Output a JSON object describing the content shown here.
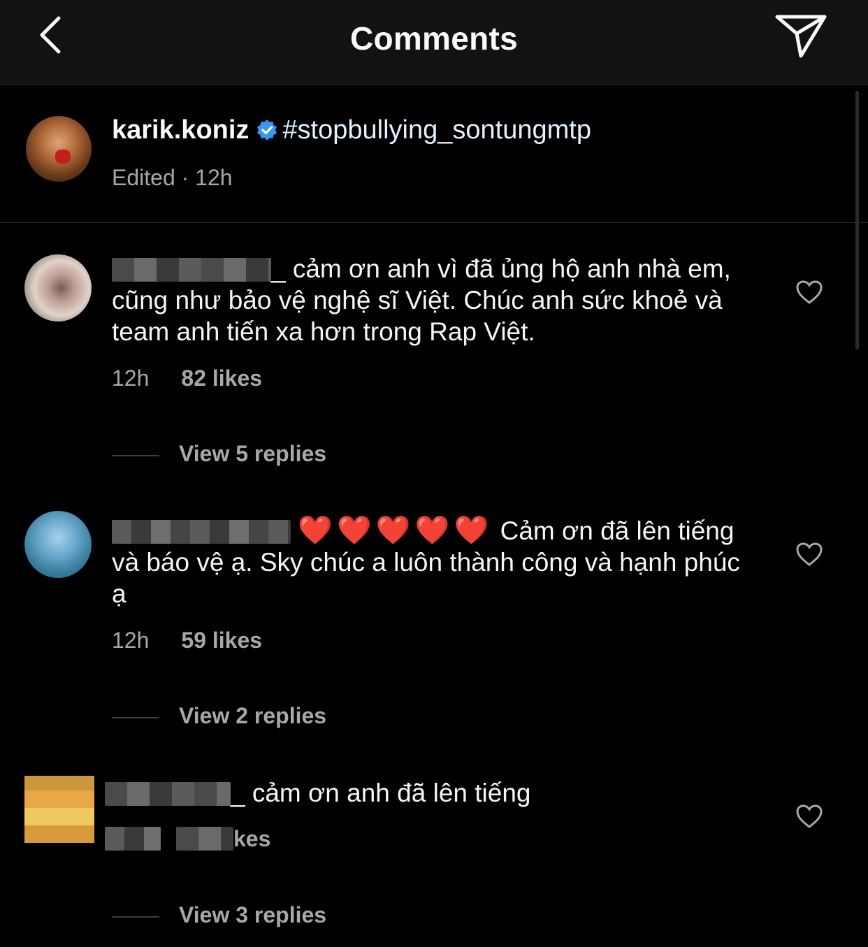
{
  "header": {
    "title": "Comments"
  },
  "caption": {
    "username": "karik.koniz",
    "text": "#stopbullying_sontungmtp",
    "meta": "Edited · 12h"
  },
  "comments": [
    {
      "text": "_ cảm ơn anh vì đã ủng hộ anh nhà em, cũng như bảo vệ nghệ sĩ Việt. Chúc anh sức khoẻ và team anh tiến xa hơn trong Rap Việt.",
      "time": "12h",
      "likes": "82 likes",
      "replies": "View 5 replies"
    },
    {
      "emoji": "❤️❤️❤️❤️❤️",
      "text": "Cảm ơn đã lên tiếng và báo vệ ạ. Sky chúc a luôn thành công và hạnh phúc ạ",
      "time": "12h",
      "likes": "59 likes",
      "replies": "View 2 replies"
    },
    {
      "text": "_ cảm ơn anh đã lên tiếng",
      "likes_partial": "kes",
      "replies": "View 3 replies"
    }
  ],
  "colors": {
    "verified": "#3897f0",
    "heart_emoji": "#ed1c2e",
    "muted_text": "#a8a8a8"
  },
  "icons": [
    "back-chevron-icon",
    "send-icon",
    "verified-badge-icon",
    "heart-outline-icon"
  ]
}
